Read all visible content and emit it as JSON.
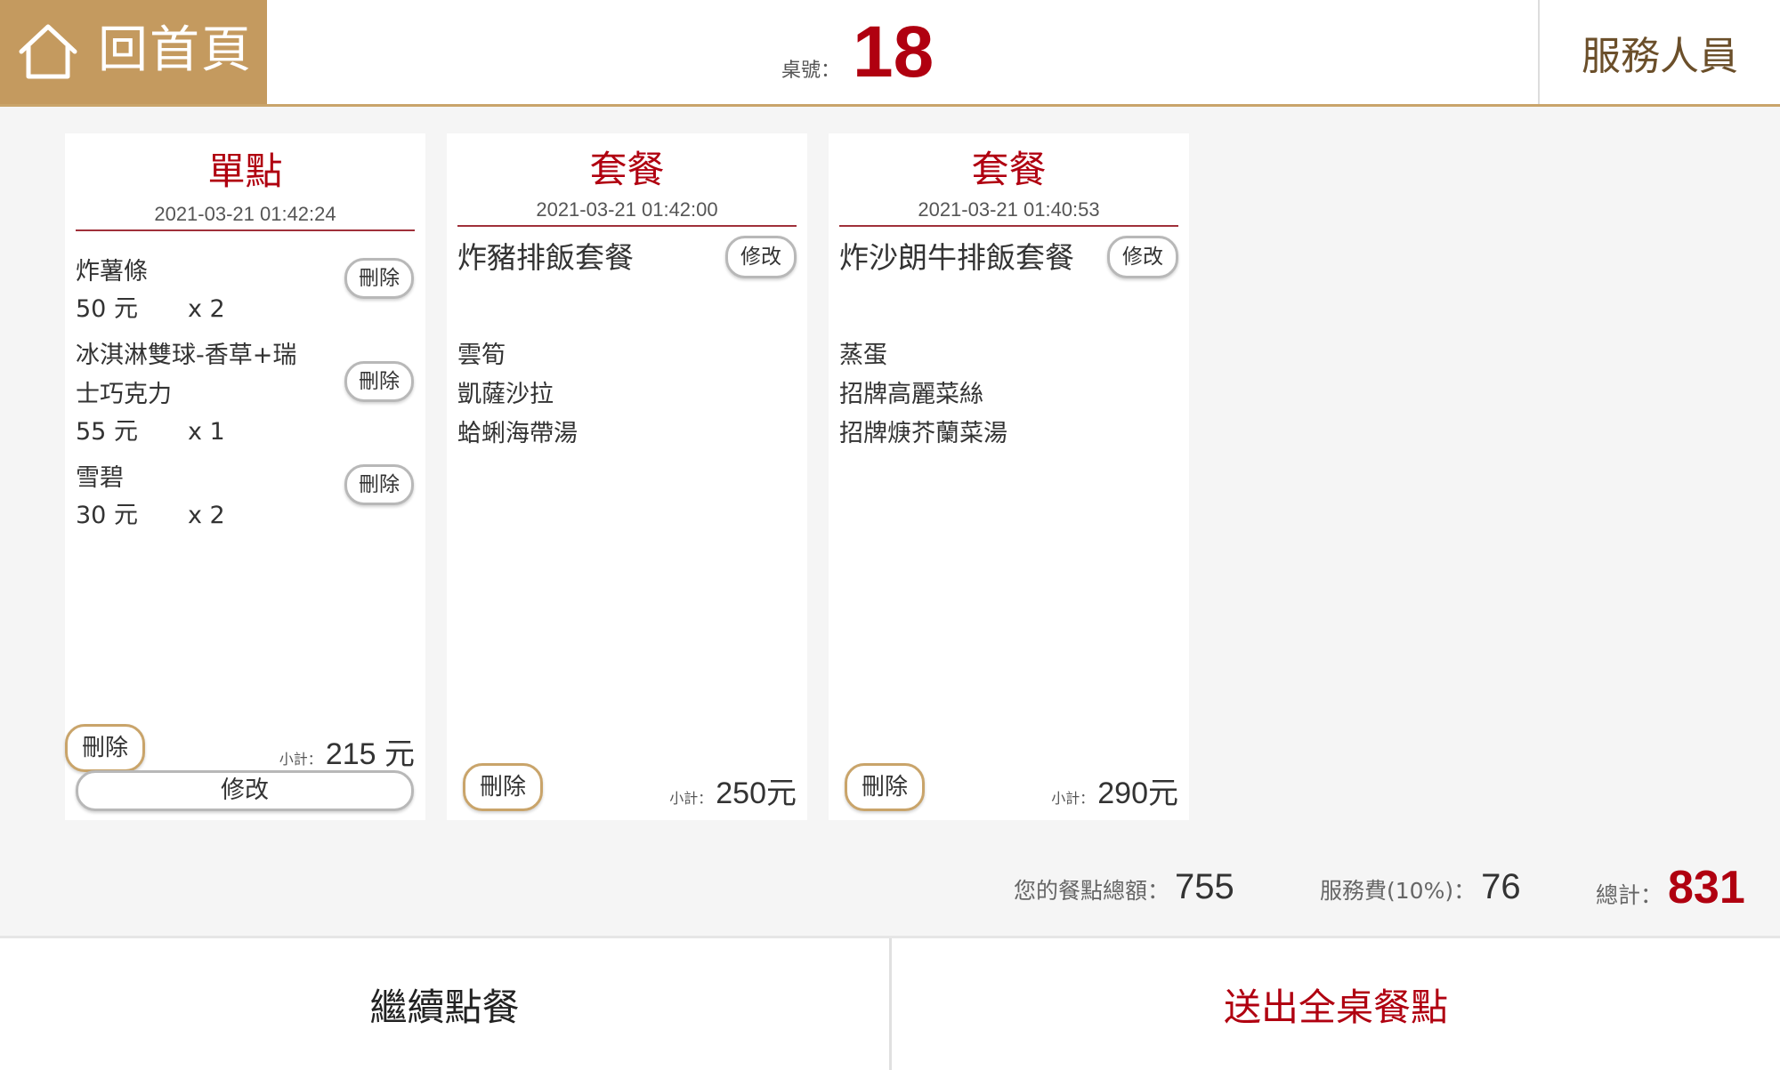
{
  "header": {
    "home_label": "回首頁",
    "table_label": "桌號：",
    "table_number": "18",
    "staff_label": "服務人員"
  },
  "orders": [
    {
      "title": "單點",
      "time": "2021-03-21 01:42:24",
      "items": [
        {
          "name": "炸薯條",
          "price": "50 元",
          "qty": "x 2",
          "delete_label": "刪除"
        },
        {
          "name_line1": "冰淇淋雙球-香草+瑞",
          "name_line2": "士巧克力",
          "price": "55 元",
          "qty": "x 1",
          "delete_label": "刪除"
        },
        {
          "name": "雪碧",
          "price": "30 元",
          "qty": "x 2",
          "delete_label": "刪除"
        }
      ],
      "delete_label": "刪除",
      "subtotal_label": "小計：",
      "subtotal": "215 元",
      "edit_label": "修改"
    },
    {
      "title": "套餐",
      "time": "2021-03-21 01:42:00",
      "set_name": "炸豬排飯套餐",
      "edit_label": "修改",
      "sides": [
        "雲筍",
        "凱薩沙拉",
        "蛤蜊海帶湯"
      ],
      "delete_label": "刪除",
      "subtotal_label": "小計：",
      "subtotal": "250元"
    },
    {
      "title": "套餐",
      "time": "2021-03-21 01:40:53",
      "set_name": "炸沙朗牛排飯套餐",
      "edit_label": "修改",
      "sides": [
        "蒸蛋",
        "招牌高麗菜絲",
        "招牌焿芥蘭菜湯"
      ],
      "delete_label": "刪除",
      "subtotal_label": "小計：",
      "subtotal": "290元"
    }
  ],
  "totals": {
    "food_label": "您的餐點總額：",
    "food_value": "755",
    "service_label": "服務費(10%)：",
    "service_value": "76",
    "grand_label": "總計：",
    "grand_value": "831"
  },
  "footer": {
    "continue_label": "繼續點餐",
    "submit_label": "送出全桌餐點"
  },
  "colors": {
    "accent_gold": "#c49a5f",
    "accent_red": "#b00010"
  }
}
